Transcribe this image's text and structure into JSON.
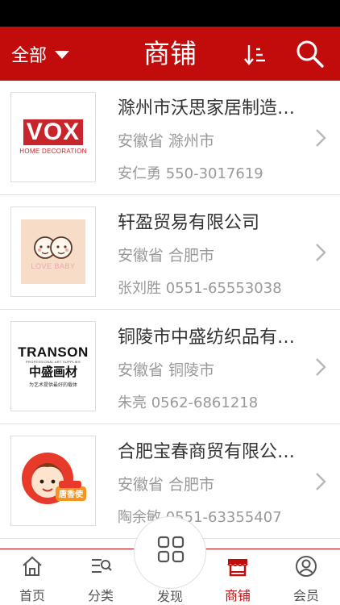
{
  "header": {
    "filter_label": "全部",
    "title": "商铺",
    "sort_icon": "sort-icon",
    "search_icon": "search-icon"
  },
  "shops": [
    {
      "name": "滁州市沃思家居制造…",
      "location": "安徽省 滁州市",
      "contact": "安仁勇 550-3017619",
      "logo": {
        "main": "VOX",
        "sub": "HOME DECORATION"
      }
    },
    {
      "name": "轩盈贸易有限公司",
      "location": "安徽省 合肥市",
      "contact": "张刘胜 0551-65553038",
      "logo": {
        "main": "LOVE BABY"
      }
    },
    {
      "name": "铜陵市中盛纺织品有…",
      "location": "安徽省 铜陵市",
      "contact": "朱亮 0562-6861218",
      "logo": {
        "main": "TRANSON",
        "sub": "PROFESSIONAL ART SUPPLIES",
        "cn": "中盛画材",
        "slogan": "为艺术提供最好的载体"
      }
    },
    {
      "name": "合肥宝春商贸有限公…",
      "location": "安徽省 合肥市",
      "contact": "陶余敏 0551-63355407",
      "logo": {
        "main": "唐香使"
      }
    }
  ],
  "tabs": [
    {
      "label": "首页",
      "icon": "home-icon"
    },
    {
      "label": "分类",
      "icon": "category-icon"
    },
    {
      "label": "发现",
      "icon": "discover-icon"
    },
    {
      "label": "商铺",
      "icon": "shop-icon",
      "active": true
    },
    {
      "label": "会员",
      "icon": "member-icon"
    }
  ],
  "colors": {
    "brand": "#c20c0c",
    "status_bar": "#000000",
    "text_primary": "#333333",
    "text_secondary": "#999999"
  }
}
